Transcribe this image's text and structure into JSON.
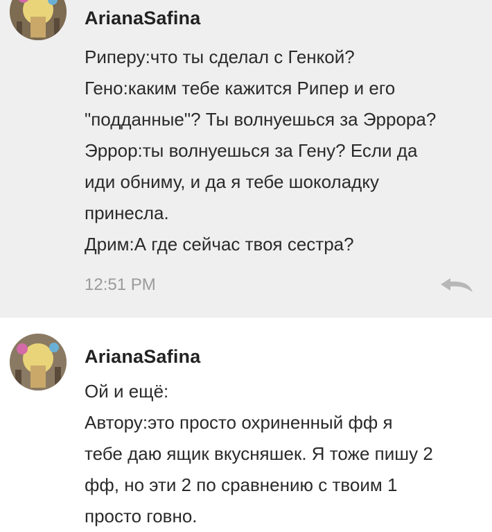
{
  "comments": [
    {
      "author": "ArianaSafina",
      "lines": [
        "Риперу:что ты сделал с Генкой?",
        "Гено:каким тебе кажится Рипер и его",
        "\"подданные\"? Ты волнуешься за Эррора?",
        "Эррор:ты волнуешься за Гену? Если да",
        "иди обниму, и да я тебе шоколадку",
        "принесла.",
        "Дрим:А где сейчас твоя сестра?"
      ],
      "time": "12:51 PM",
      "reply_icon": "reply-arrow-icon"
    },
    {
      "author": "ArianaSafina",
      "lines": [
        "Ой и ещё:",
        "Автору:это просто охриненный фф я",
        "тебе даю ящик вкусняшек. Я тоже пишу 2",
        "фф, но эти 2 по сравнению с твоим 1",
        "просто говно."
      ]
    }
  ],
  "colors": {
    "first_comment_bg": "#efefef",
    "second_comment_bg": "#ffffff",
    "time_color": "#9a9a9a"
  }
}
